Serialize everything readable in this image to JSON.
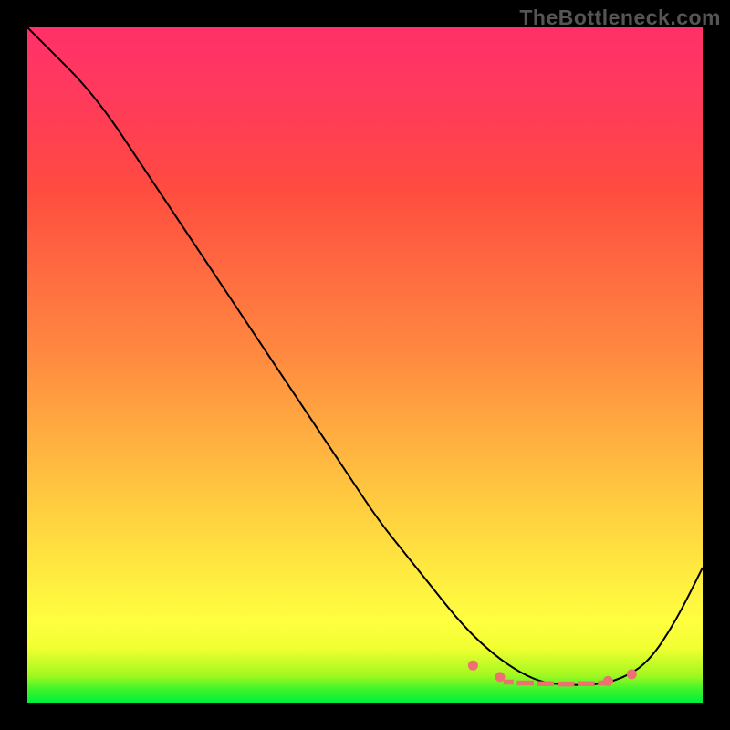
{
  "watermark": "TheBottleneck.com",
  "chart_data": {
    "type": "line",
    "title": "",
    "xlabel": "",
    "ylabel": "",
    "xlim": [
      0,
      100
    ],
    "ylim": [
      0,
      100
    ],
    "series": [
      {
        "name": "curve",
        "x": [
          0,
          4,
          8,
          12,
          16,
          20,
          24,
          28,
          32,
          36,
          40,
          44,
          48,
          52,
          56,
          60,
          64,
          68,
          72,
          76,
          80,
          84,
          88,
          92,
          96,
          100
        ],
        "y": [
          100,
          96,
          92,
          87,
          81,
          75,
          69,
          63,
          57,
          51,
          45,
          39,
          33,
          27,
          22,
          17,
          12,
          8,
          5,
          3,
          2.6,
          2.6,
          3.5,
          6,
          12,
          20
        ]
      }
    ],
    "highlight_dots": {
      "name": "highlight-dots",
      "x": [
        66,
        70,
        86,
        89.5
      ],
      "y": [
        5.5,
        3.8,
        3.2,
        4.2
      ]
    },
    "highlight_dashes": {
      "name": "highlight-dashes",
      "segments": [
        {
          "x0": 70.5,
          "x1": 72.0,
          "y": 3.04
        },
        {
          "x0": 72.5,
          "x1": 75.0,
          "y": 2.9
        },
        {
          "x0": 75.5,
          "x1": 78.0,
          "y": 2.8
        },
        {
          "x0": 78.5,
          "x1": 81.0,
          "y": 2.76
        },
        {
          "x0": 81.5,
          "x1": 84.0,
          "y": 2.8
        },
        {
          "x0": 84.5,
          "x1": 86.5,
          "y": 2.9
        }
      ]
    }
  }
}
